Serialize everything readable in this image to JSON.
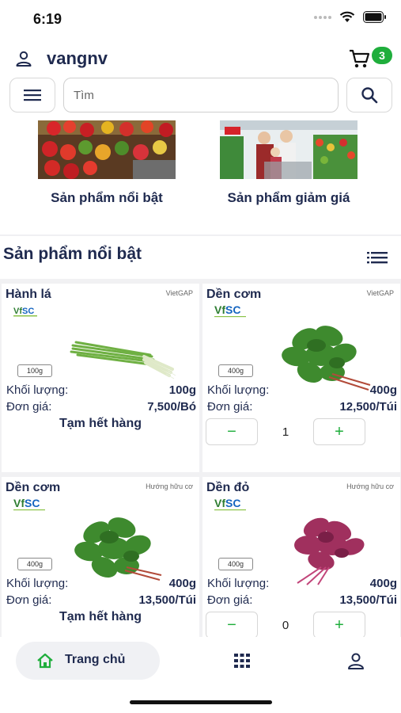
{
  "status_bar": {
    "time": "6:19"
  },
  "header": {
    "username": "vangnv",
    "cart_count": "3"
  },
  "search": {
    "placeholder": "Tìm",
    "value": ""
  },
  "categories": [
    {
      "label": "Sản phẩm nổi bật"
    },
    {
      "label": "Sản phẩm giảm giá"
    }
  ],
  "section": {
    "title": "Sản phẩm nổi bật"
  },
  "labels": {
    "weight": "Khối lượng:",
    "unit_price": "Đơn giá:",
    "out_of_stock": "Tạm hết hàng"
  },
  "products": [
    {
      "name": "Hành lá",
      "tag": "VietGAP",
      "weight_box": "100g",
      "weight": "100g",
      "price": "7,500/Bó",
      "in_stock": false,
      "quantity": "",
      "color": "#7fb84a"
    },
    {
      "name": "Dền cơm",
      "tag": "VietGAP",
      "weight_box": "400g",
      "weight": "400g",
      "price": "12,500/Túi",
      "in_stock": true,
      "quantity": "1",
      "color": "#3e8a2e"
    },
    {
      "name": "Dền cơm",
      "tag": "Hướng hữu cơ",
      "weight_box": "400g",
      "weight": "400g",
      "price": "13,500/Túi",
      "in_stock": false,
      "quantity": "",
      "color": "#3e8a2e"
    },
    {
      "name": "Dền đỏ",
      "tag": "Hướng hữu cơ",
      "weight_box": "400g",
      "weight": "400g",
      "price": "13,500/Túi",
      "in_stock": true,
      "quantity": "0",
      "color": "#a0305e"
    }
  ],
  "logo_text": "VfSC",
  "bottom_nav": {
    "home_label": "Trang chủ"
  },
  "colors": {
    "accent": "#1fae3c",
    "text": "#1f2a4f",
    "badge": "#1fae3c"
  }
}
